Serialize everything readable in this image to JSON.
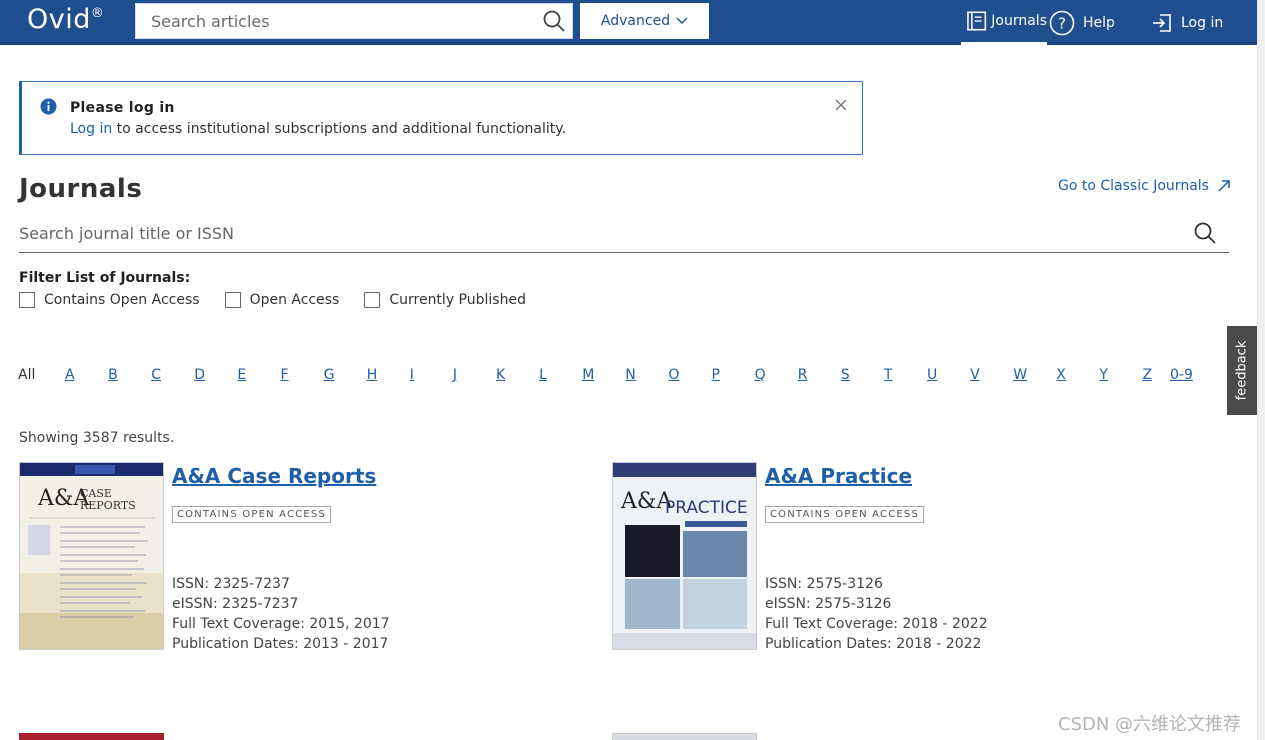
{
  "header": {
    "logo": "Ovid",
    "logo_mark": "®",
    "search_placeholder": "Search articles",
    "advanced_label": "Advanced",
    "nav": {
      "journals": "Journals",
      "help": "Help",
      "login": "Log in"
    },
    "bar_color": "#1f4f8f"
  },
  "alert": {
    "title": "Please log in",
    "link_text": "Log in",
    "message": " to access institutional subscriptions and additional functionality."
  },
  "page": {
    "title": "Journals",
    "classic_link": "Go to Classic Journals",
    "search_placeholder": "Search journal title or ISSN",
    "filter_label": "Filter List of Journals:",
    "filters": [
      "Contains Open Access",
      "Open Access",
      "Currently Published"
    ],
    "alphabet_all": "All",
    "alphabet": [
      "A",
      "B",
      "C",
      "D",
      "E",
      "F",
      "G",
      "H",
      "I",
      "J",
      "K",
      "L",
      "M",
      "N",
      "O",
      "P",
      "Q",
      "R",
      "S",
      "T",
      "U",
      "V",
      "W",
      "X",
      "Y",
      "Z",
      "0-9"
    ],
    "results_count": "Showing 3587 results.",
    "feedback": "feedback"
  },
  "journals": [
    {
      "title": "A&A Case Reports",
      "badge": "CONTAINS OPEN ACCESS",
      "issn": "ISSN: 2325-7237",
      "eissn": "eISSN: 2325-7237",
      "coverage": "Full Text Coverage: 2015, 2017",
      "dates": "Publication Dates: 2013 - 2017",
      "cover_logo": "A&A",
      "cover_word": "CASE REPORTS"
    },
    {
      "title": "A&A Practice",
      "badge": "CONTAINS OPEN ACCESS",
      "issn": "ISSN: 2575-3126",
      "eissn": "eISSN: 2575-3126",
      "coverage": "Full Text Coverage: 2018 - 2022",
      "dates": "Publication Dates: 2018 - 2022",
      "cover_logo": "A&A",
      "cover_word": "PRACTICE"
    }
  ],
  "watermark": "CSDN @六维论文推荐"
}
